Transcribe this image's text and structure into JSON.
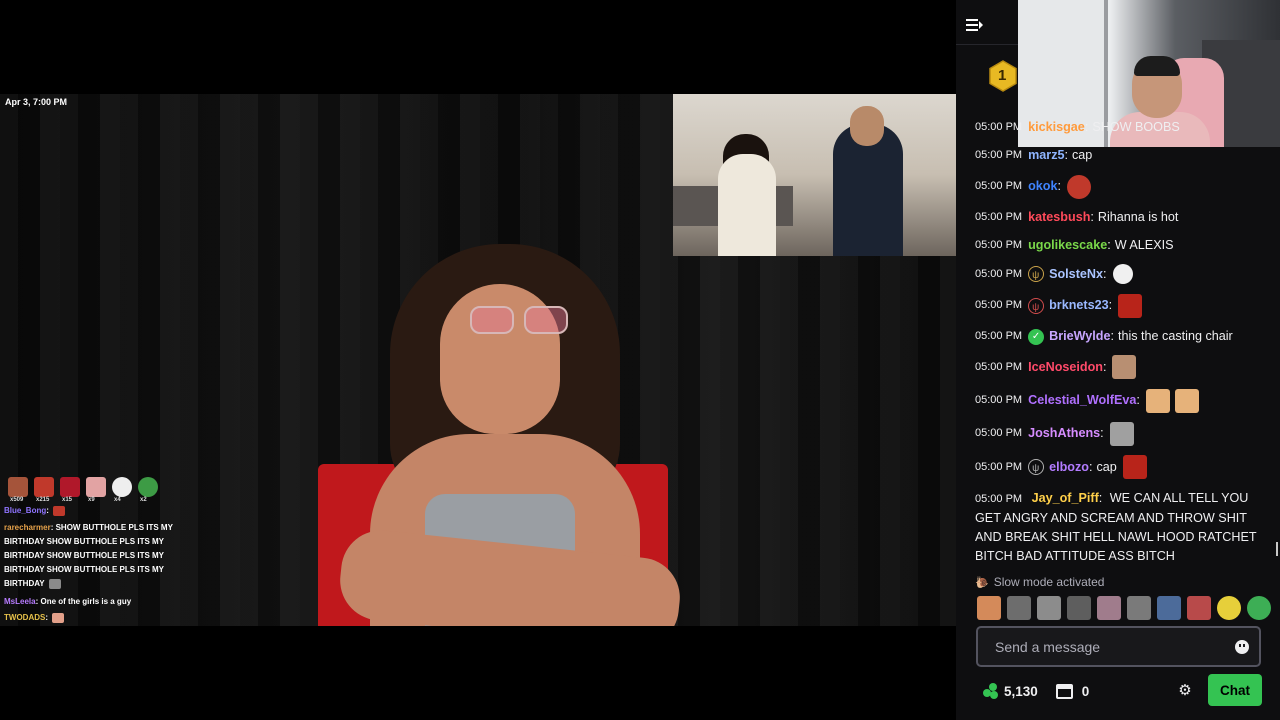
{
  "video": {
    "timestamp": "Apr 3, 7:00 PM"
  },
  "overlay_chat": {
    "emote_counts": [
      "x509",
      "x215",
      "x15",
      "x9",
      "x4",
      "x2"
    ],
    "lines": [
      {
        "user": "Blue_Bong",
        "user_color": "#8f74ff",
        "text": ""
      },
      {
        "user": "rarecharmer",
        "user_color": "#e6a24a",
        "text": "SHOW BUTTHOLE PLS  ITS MY"
      },
      {
        "user": "",
        "user_color": "#fff",
        "text": "BIRTHDAY  SHOW BUTTHOLE PLS  ITS MY"
      },
      {
        "user": "",
        "user_color": "#fff",
        "text": "BIRTHDAY  SHOW BUTTHOLE PLS  ITS MY"
      },
      {
        "user": "",
        "user_color": "#fff",
        "text": "BIRTHDAY  SHOW BUTTHOLE PLS  ITS MY"
      },
      {
        "user": "",
        "user_color": "#fff",
        "text": "BIRTHDAY"
      },
      {
        "user": "MsLeela",
        "user_color": "#b77cff",
        "text": "One of the girls is a guy"
      },
      {
        "user": "TWODADS",
        "user_color": "#e6c14a",
        "text": ""
      }
    ]
  },
  "sidebar": {
    "rank_badge": "1",
    "messages": [
      {
        "time": "05:00 PM",
        "user": "kickisgae",
        "color": "#ff9b3d",
        "text": "SHOW BOOBS",
        "badge": "",
        "emotes": 0
      },
      {
        "time": "05:00 PM",
        "user": "marz5",
        "color": "#8fb5ff",
        "text": "cap",
        "badge": "",
        "emotes": 0
      },
      {
        "time": "05:00 PM",
        "user": "okok",
        "color": "#3f84ff",
        "text": "",
        "badge": "",
        "emotes": 1
      },
      {
        "time": "05:00 PM",
        "user": "katesbush",
        "color": "#ff4a5a",
        "text": "Rihanna is hot",
        "badge": "",
        "emotes": 0
      },
      {
        "time": "05:00 PM",
        "user": "ugolikescake",
        "color": "#7ad84a",
        "text": "W ALEXIS",
        "badge": "",
        "emotes": 0
      },
      {
        "time": "05:00 PM",
        "user": "SolsteNx",
        "color": "#aac4ff",
        "text": "",
        "badge": "gold",
        "emotes": 1
      },
      {
        "time": "05:00 PM",
        "user": "brknets23",
        "color": "#9ab8ff",
        "text": "",
        "badge": "red",
        "emotes": 1
      },
      {
        "time": "05:00 PM",
        "user": "BrieWylde",
        "color": "#c8a6ff",
        "text": "this the casting chair",
        "badge": "verified",
        "emotes": 0
      },
      {
        "time": "05:00 PM",
        "user": "IceNoseidon",
        "color": "#ff4a6a",
        "text": "",
        "badge": "",
        "emotes": 1
      },
      {
        "time": "05:00 PM",
        "user": "Celestial_WolfEva",
        "color": "#b070ff",
        "text": "",
        "badge": "",
        "emotes": 2
      },
      {
        "time": "05:00 PM",
        "user": "JoshAthens",
        "color": "#d68cff",
        "text": "",
        "badge": "",
        "emotes": 1
      },
      {
        "time": "05:00 PM",
        "user": "elbozo",
        "color": "#b37cff",
        "text": "cap",
        "badge": "grey",
        "emotes": 1
      },
      {
        "time": "05:00 PM",
        "user": "Jay_of_Piff",
        "color": "#ffd04a",
        "text": "WE CAN ALL TELL YOU GET ANGRY AND SCREAM AND THROW SHIT AND BREAK SHIT HELL NAWL HOOD RATCHET BITCH BAD ATTITUDE ASS BITCH",
        "badge": "",
        "emotes": 0
      }
    ],
    "slow_mode": "Slow mode activated",
    "input_placeholder": "Send a message",
    "points": "5,130",
    "store_count": "0",
    "chat_button": "Chat",
    "accent": "#34c352"
  }
}
